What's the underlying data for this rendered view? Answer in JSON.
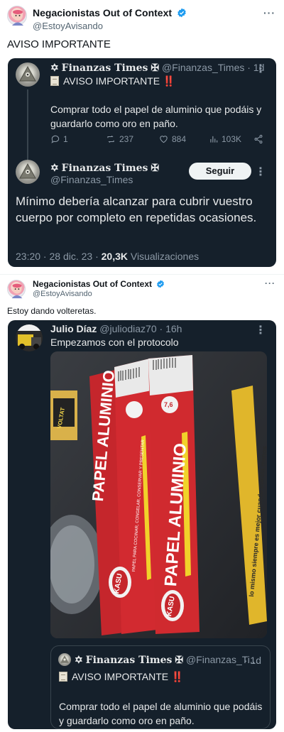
{
  "outer_post_1": {
    "author_name": "Negacionistas Out of Context",
    "author_handle": "@EstoyAvisando",
    "body": "AVISO IMPORTANTE"
  },
  "card_1": {
    "quoted": {
      "name": "Finanzas Times",
      "handle": "@Finanzas_Times",
      "time": "· 1d",
      "headline": "AVISO IMPORTANTE",
      "alert": "‼️",
      "body": "Comprar todo el papel de aluminio que podáis y guardarlo como oro en paño.",
      "stats": {
        "replies": "1",
        "reposts": "237",
        "likes": "884",
        "views": "103K"
      }
    },
    "reply": {
      "name": "Finanzas Times",
      "handle": "@Finanzas_Times",
      "follow_label": "Seguir",
      "body": "Mínimo debería alcanzar para cubrir vuestro cuerpo por completo en repetidas ocasiones.",
      "timestamp": "23:20 · 28 dic. 23 ·",
      "views_count": "20,3K",
      "views_label": "Visualizaciones"
    }
  },
  "outer_post_2": {
    "author_name": "Negacionistas Out of Context",
    "author_handle": "@EstoyAvisando",
    "body": "Estoy dando volteretas."
  },
  "card_2": {
    "author_name": "Julio Díaz",
    "author_handle": "@juliodiaz70",
    "time": "· 16h",
    "body": "Empezamos con el protocolo",
    "photo": {
      "product_title": "PAPEL ALUMINIO",
      "product_subtitle": "PAPEL PARA COCINAR, CONGELAR, CONSERVAR Y PRESENTAR",
      "brand": "KASU",
      "length": "7,6",
      "yellow_box_text": "lo mismo siempre es mejor cuando cuesta menos",
      "battery_text": "VOLTAT"
    },
    "quote": {
      "name": "Finanzas Times",
      "handle": "@Finanzas_Ti...",
      "time": "· 1d",
      "headline": "AVISO IMPORTANTE",
      "alert": "‼️",
      "body": "Comprar todo el papel de aluminio que podáis y guardarlo como oro en paño."
    }
  },
  "colors": {
    "dark_bg": "#15202b",
    "verified_blue": "#1d9bf0",
    "alert_red": "#f4212e"
  }
}
